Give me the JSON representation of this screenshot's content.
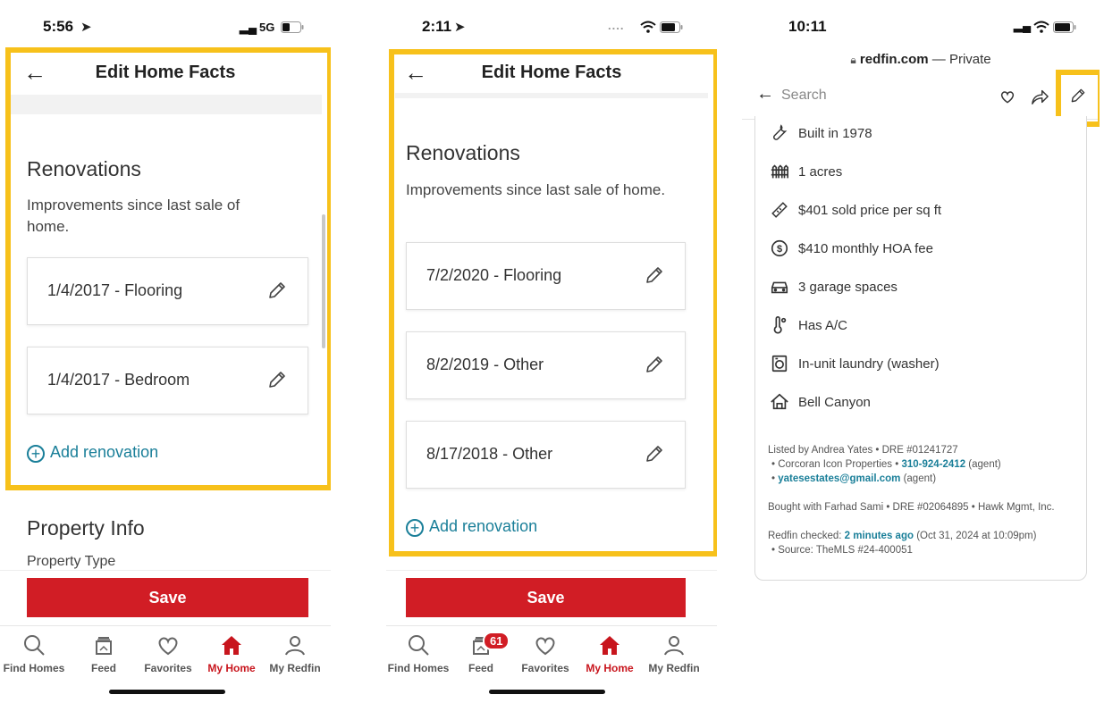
{
  "screens": [
    {
      "status_time": "5:56",
      "status_right": "5G",
      "header_title": "Edit Home Facts",
      "section_title": "Renovations",
      "section_desc": "Improvements since last sale of home.",
      "renovations": [
        "1/4/2017 - Flooring",
        "1/4/2017 - Bedroom"
      ],
      "add_label": "Add renovation",
      "next_section": "Property Info",
      "next_subtitle": "Property Type",
      "save_label": "Save"
    },
    {
      "status_time": "2:11",
      "header_title": "Edit Home Facts",
      "section_title": "Renovations",
      "section_desc": "Improvements since last sale of home.",
      "renovations": [
        "7/2/2020 - Flooring",
        "8/2/2019 - Other",
        "8/17/2018 - Other"
      ],
      "add_label": "Add renovation",
      "save_label": "Save",
      "feed_badge": "61"
    },
    {
      "status_time": "10:11",
      "url_domain": "redfin.com",
      "url_suffix": " — Private",
      "search_placeholder": "Search",
      "facts": [
        {
          "icon": "wrench-icon",
          "text": "Built in 1978"
        },
        {
          "icon": "fence-icon",
          "text": "1 acres"
        },
        {
          "icon": "ruler-icon",
          "text": "$401 sold price per sq ft"
        },
        {
          "icon": "dollar-circle-icon",
          "text": "$410 monthly HOA fee"
        },
        {
          "icon": "car-icon",
          "text": "3 garage spaces"
        },
        {
          "icon": "thermometer-icon",
          "text": "Has A/C"
        },
        {
          "icon": "washer-icon",
          "text": "In-unit laundry (washer)"
        },
        {
          "icon": "house-icon",
          "text": "Bell Canyon"
        }
      ],
      "listing": {
        "listed_by": "Listed by Andrea Yates • DRE #01241727",
        "brokerage": "• Corcoran Icon Properties • ",
        "phone": "310-924-2412",
        "phone_note": " (agent)",
        "email_prefix": "• ",
        "email": "yatesestates@gmail.com",
        "email_note": " (agent)",
        "bought_with": "Bought with Farhad Sami • DRE #02064895 •  Hawk Mgmt, Inc.",
        "checked_prefix": "Redfin checked: ",
        "checked_time": "2 minutes ago",
        "checked_suffix": " (Oct 31, 2024 at 10:09pm)",
        "source": "• Source:  TheMLS #24-400051"
      }
    }
  ],
  "tabs": [
    "Find Homes",
    "Feed",
    "Favorites",
    "My Home",
    "My Redfin"
  ],
  "colors": {
    "highlight": "#f7c11b",
    "save": "#d11d25",
    "link": "#1a7f99",
    "active_tab": "#c8151d"
  }
}
